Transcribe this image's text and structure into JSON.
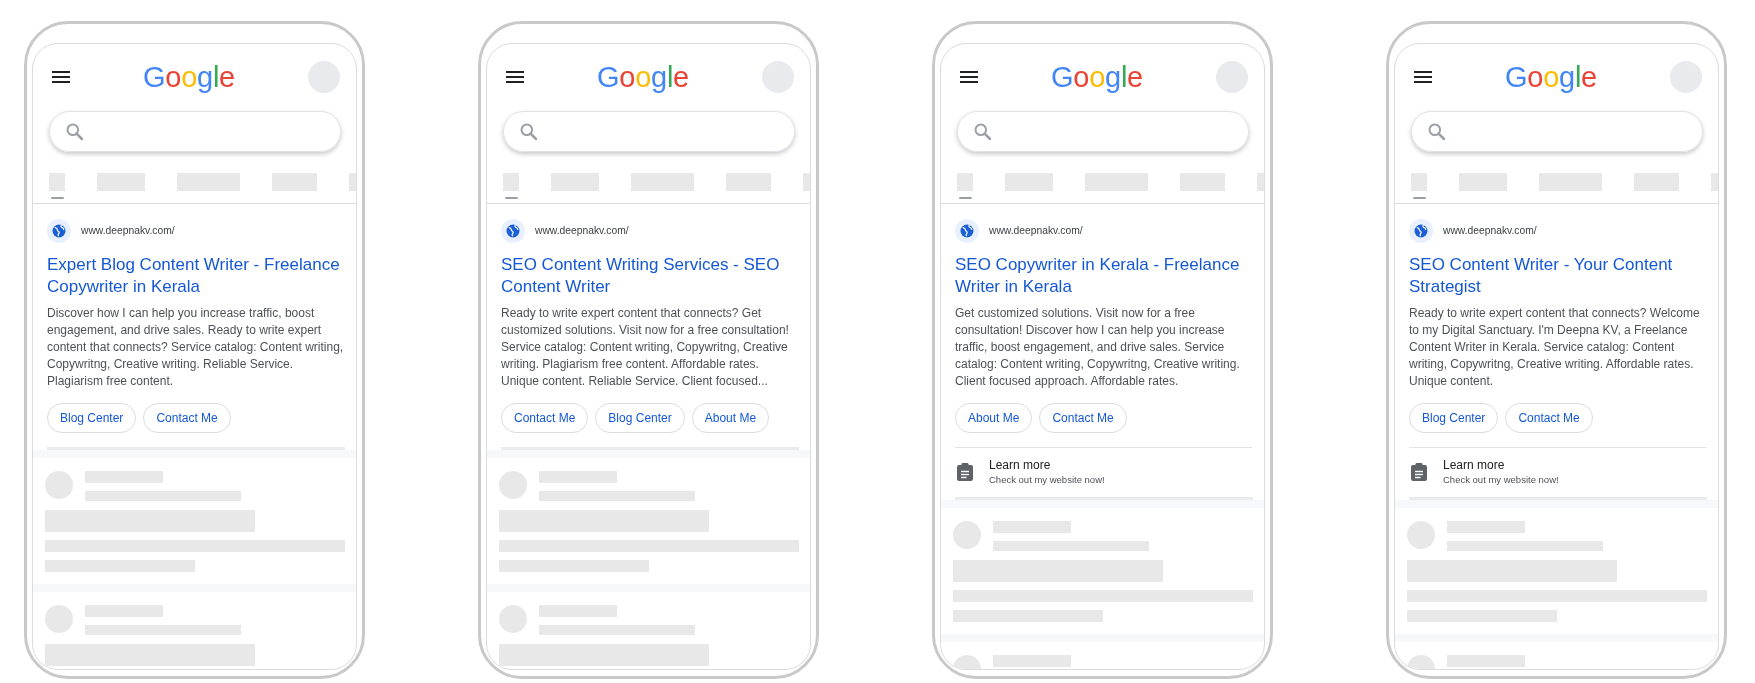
{
  "phones": [
    {
      "logo": "Google",
      "tabs": [
        {
          "selected": true
        },
        {
          "selected": false
        },
        {
          "selected": false
        },
        {
          "selected": false
        },
        {
          "selected": false
        }
      ],
      "ad": {
        "url": "www.deepnakv.com/",
        "title": "Expert Blog Content Writer - Freelance Copywriter in Kerala",
        "description": "Discover how I can help you increase traffic, boost engagement, and drive sales. Ready to write expert content that connects? Service catalog: Content writing, Copywritng, Creative writing. Reliable Service. Plagiarism free content.",
        "sitelinks": [
          "Blog Center",
          "Contact Me"
        ]
      }
    },
    {
      "logo": "Google",
      "tabs": [
        {
          "selected": true
        },
        {
          "selected": false
        },
        {
          "selected": false
        },
        {
          "selected": false
        },
        {
          "selected": false
        }
      ],
      "ad": {
        "url": "www.deepnakv.com/",
        "title": "SEO Content Writing Services - SEO Content Writer",
        "description": "Ready to write expert content that connects? Get customized solutions. Visit now for a free consultation! Service catalog: Content writing, Copywritng, Creative writing. Plagiarism free content. Affordable rates. Unique content. Reliable Service. Client focused...",
        "sitelinks": [
          "Contact Me",
          "Blog Center",
          "About Me"
        ]
      }
    },
    {
      "logo": "Google",
      "tabs": [
        {
          "selected": true
        },
        {
          "selected": false
        },
        {
          "selected": false
        },
        {
          "selected": false
        },
        {
          "selected": false
        }
      ],
      "ad": {
        "url": "www.deepnakv.com/",
        "title": "SEO Copywriter in Kerala - Freelance Writer in Kerala",
        "description": "Get customized solutions. Visit now for a free consultation! Discover how I can help you increase traffic, boost engagement, and drive sales. Service catalog: Content writing, Copywritng, Creative writing. Client focused approach. Affordable rates.",
        "sitelinks": [
          "About Me",
          "Contact Me"
        ],
        "extension": {
          "title": "Learn more",
          "description": "Check out my website now!"
        }
      }
    },
    {
      "logo": "Google",
      "tabs": [
        {
          "selected": true
        },
        {
          "selected": false
        },
        {
          "selected": false
        },
        {
          "selected": false
        },
        {
          "selected": false
        }
      ],
      "ad": {
        "url": "www.deepnakv.com/",
        "title": "SEO Content Writer - Your Content Strategist",
        "description": "Ready to write expert content that connects? Welcome to my Digital Sanctuary. I'm Deepna KV, a Freelance Content Writer in Kerala. Service catalog: Content writing, Copywritng, Creative writing. Affordable rates. Unique content.",
        "sitelinks": [
          "Blog Center",
          "Contact Me"
        ],
        "extension": {
          "title": "Learn more",
          "description": "Check out my website now!"
        }
      }
    }
  ]
}
